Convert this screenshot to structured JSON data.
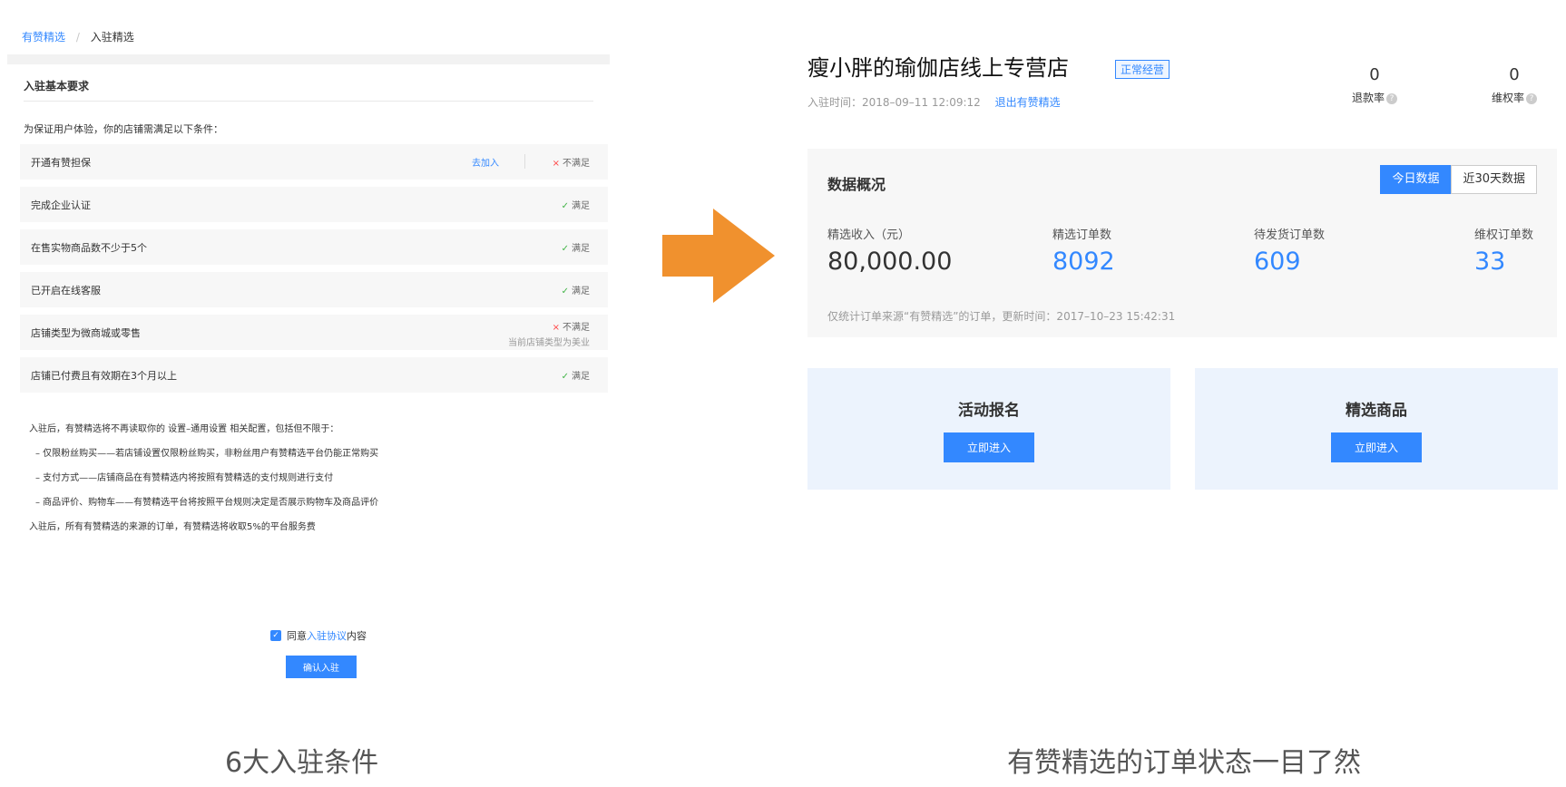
{
  "left": {
    "breadcrumb": {
      "home": "有赞精选",
      "separator": "/",
      "current": "入驻精选"
    },
    "heading": "入驻基本要求",
    "intro": "为保证用户体验，你的店铺需满足以下条件：",
    "requirements": [
      {
        "label": "开通有赞担保",
        "action": "去加入",
        "mark": "×",
        "status": "不满足",
        "note": ""
      },
      {
        "label": "完成企业认证",
        "action": "",
        "mark": "✓",
        "status": "满足",
        "note": ""
      },
      {
        "label": "在售实物商品数不少于5个",
        "action": "",
        "mark": "✓",
        "status": "满足",
        "note": ""
      },
      {
        "label": "已开启在线客服",
        "action": "",
        "mark": "✓",
        "status": "满足",
        "note": ""
      },
      {
        "label": "店铺类型为微商城或零售",
        "action": "",
        "mark": "×",
        "status": "不满足",
        "note": "当前店铺类型为美业"
      },
      {
        "label": "店铺已付费且有效期在3个月以上",
        "action": "",
        "mark": "✓",
        "status": "满足",
        "note": ""
      }
    ],
    "notes": [
      "入驻后，有赞精选将不再读取你的 设置–通用设置 相关配置，包括但不限于：",
      "– 仅限粉丝购买——若店铺设置仅限粉丝购买，非粉丝用户有赞精选平台仍能正常购买",
      "– 支付方式——店铺商品在有赞精选内将按照有赞精选的支付规则进行支付",
      "– 商品评价、购物车——有赞精选平台将按照平台规则决定是否展示购物车及商品评价",
      "入驻后，所有有赞精选的来源的订单，有赞精选将收取5%的平台服务费"
    ],
    "agree": {
      "prefix": "同意",
      "link": "入驻协议",
      "suffix": "内容",
      "checked": true
    },
    "confirm_label": "确认入驻"
  },
  "right": {
    "shop_name": "瘦小胖的瑜伽店线上专营店",
    "badge": "正常经营",
    "join_time": "入驻时间：2018–09–11 12:09:12",
    "exit_link": "退出有赞精选",
    "refund_rate": {
      "value": "0",
      "label": "退款率"
    },
    "rights_rate": {
      "value": "0",
      "label": "维权率"
    },
    "overview": {
      "title": "数据概况",
      "tabs": [
        "今日数据",
        "近30天数据"
      ],
      "metrics": [
        {
          "label": "精选收入（元）",
          "value": "80,000.00"
        },
        {
          "label": "精选订单数",
          "value": "8092"
        },
        {
          "label": "待发货订单数",
          "value": "609"
        },
        {
          "label": "维权订单数",
          "value": "33"
        }
      ],
      "note": "仅统计订单来源“有赞精选”的订单，更新时间：2017–10–23 15:42:31"
    },
    "entries": [
      {
        "title": "活动报名",
        "button": "立即进入"
      },
      {
        "title": "精选商品",
        "button": "立即进入"
      }
    ]
  },
  "captions": {
    "left": "6大入驻条件",
    "right": "有赞精选的订单状态一目了然"
  },
  "colors": {
    "accent": "#3388ff",
    "arrow": "#f0912e",
    "ok": "#44b549",
    "error": "#ff4444"
  }
}
